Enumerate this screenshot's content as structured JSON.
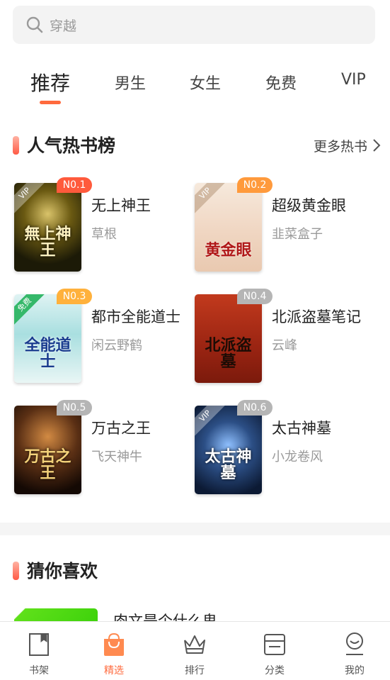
{
  "search": {
    "placeholder": "穿越"
  },
  "tabs": [
    {
      "label": "推荐",
      "active": true
    },
    {
      "label": "男生"
    },
    {
      "label": "女生"
    },
    {
      "label": "免费"
    },
    {
      "label": "VIP"
    }
  ],
  "hot": {
    "title": "人气热书榜",
    "more": "更多热书",
    "books": [
      {
        "rank": "N0.1",
        "title": "无上神王",
        "author": "草根",
        "badge": "VIP",
        "cover_text": "無上神王",
        "rank_color": "#ff5a3c"
      },
      {
        "rank": "N0.2",
        "title": "超级黄金眼",
        "author": "韭菜盒子",
        "badge": "VIP",
        "cover_text": "黄金眼",
        "rank_color": "#ff9a3c"
      },
      {
        "rank": "N0.3",
        "title": "都市全能道士",
        "author": "闲云野鹤",
        "badge": "免费",
        "cover_text": "全能道士",
        "rank_color": "#ffb13c"
      },
      {
        "rank": "N0.4",
        "title": "北派盗墓笔记",
        "author": "云峰",
        "badge": "",
        "cover_text": "北派盗墓",
        "rank_color": "#b5b5b5"
      },
      {
        "rank": "N0.5",
        "title": "万古之王",
        "author": "飞天神牛",
        "badge": "",
        "cover_text": "万古之王",
        "rank_color": "#b5b5b5"
      },
      {
        "rank": "N0.6",
        "title": "太古神墓",
        "author": "小龙卷风",
        "badge": "VIP",
        "cover_text": "太古神墓",
        "rank_color": "#b5b5b5"
      }
    ]
  },
  "guess": {
    "title": "猜你喜欢",
    "first_title": "肉文是个什么鬼"
  },
  "nav": [
    {
      "label": "书架",
      "icon": "bookshelf-icon"
    },
    {
      "label": "精选",
      "icon": "bag-icon",
      "active": true
    },
    {
      "label": "排行",
      "icon": "crown-icon"
    },
    {
      "label": "分类",
      "icon": "category-icon"
    },
    {
      "label": "我的",
      "icon": "profile-icon"
    }
  ],
  "colors": {
    "accent": "#ff6a3d"
  }
}
